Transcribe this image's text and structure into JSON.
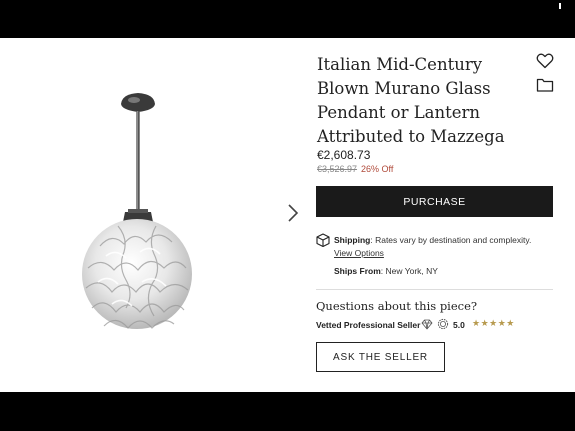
{
  "product": {
    "title": "Italian Mid-Century Blown Murano Glass Pendant or Lantern Attributed to Mazzega",
    "price": "€2,608.73",
    "original_price": "€3,526.97",
    "discount": "26% Off"
  },
  "actions": {
    "purchase_label": "PURCHASE",
    "ask_seller_label": "ASK THE SELLER"
  },
  "shipping": {
    "label": "Shipping",
    "text": ": Rates vary by destination and complexity.",
    "view_options": "View Options",
    "ships_from_label": "Ships From",
    "ships_from_value": ": New York, NY"
  },
  "seller": {
    "questions": "Questions about this piece?",
    "vetted_label": "Vetted Professional Seller",
    "rating": "5.0",
    "stars": "★★★★★"
  },
  "icons": {
    "favorite": "heart-icon",
    "collection": "folder-icon",
    "next": "chevron-right-icon",
    "shipping": "box-icon",
    "diamond": "diamond-icon",
    "badge": "badge-icon"
  },
  "colors": {
    "button_dark": "#1a1a1a",
    "discount": "#b04a3a",
    "stars": "#b79a4e"
  }
}
